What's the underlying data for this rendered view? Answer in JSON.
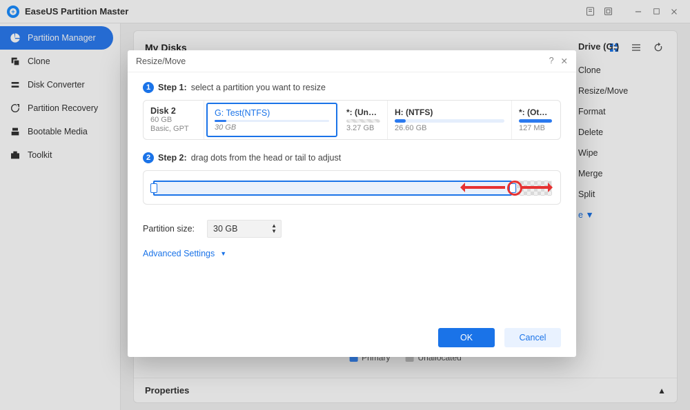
{
  "app": {
    "title": "EaseUS Partition Master"
  },
  "sidebar": {
    "items": [
      {
        "label": "Partition Manager"
      },
      {
        "label": "Clone"
      },
      {
        "label": "Disk Converter"
      },
      {
        "label": "Partition Recovery"
      },
      {
        "label": "Bootable Media"
      },
      {
        "label": "Toolkit"
      }
    ]
  },
  "panel": {
    "title": "My Disks"
  },
  "right": {
    "title": "Drive (G:)",
    "ops": [
      "Clone",
      "Resize/Move",
      "Format",
      "Delete",
      "Wipe",
      "Merge",
      "Split"
    ],
    "more": "e  ▼"
  },
  "legend": {
    "primary": "Primary",
    "unallocated": "Unallocated"
  },
  "properties_label": "Properties",
  "modal": {
    "title": "Resize/Move",
    "step1_key": "Step 1:",
    "step1_text": "select a partition you want to resize",
    "disk": {
      "name": "Disk 2",
      "size": "60 GB",
      "type": "Basic, GPT"
    },
    "parts": {
      "sel": {
        "name": "G: Test(NTFS)",
        "size": "30 GB"
      },
      "un1": {
        "name": "*: (Unallo…",
        "size": "3.27 GB"
      },
      "h": {
        "name": "H: (NTFS)",
        "size": "26.60 GB"
      },
      "un2": {
        "name": "*: (Oth…",
        "size": "127 MB"
      }
    },
    "step2_key": "Step 2:",
    "step2_text": "drag dots from the head or tail to adjust",
    "size_label": "Partition size:",
    "size_value": "30 GB",
    "advanced": "Advanced Settings",
    "ok": "OK",
    "cancel": "Cancel"
  }
}
